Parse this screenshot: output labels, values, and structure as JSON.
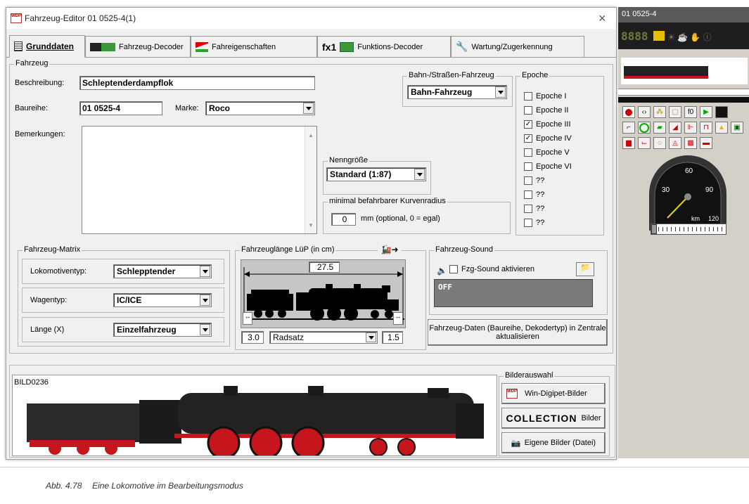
{
  "window": {
    "title": "Fahrzeug-Editor 01 0525-4(1)",
    "close": "×"
  },
  "tabs": [
    {
      "label": "Grunddaten"
    },
    {
      "label": "Fahrzeug-Decoder"
    },
    {
      "label": "Fahreigenschaften"
    },
    {
      "label": "Funktions-Decoder",
      "prefix": "fx1"
    },
    {
      "label": "Wartung/Zugerkennung"
    }
  ],
  "fahrzeug": {
    "legend": "Fahrzeug",
    "beschreibung_label": "Beschreibung:",
    "beschreibung_value": "Schleptenderdampflok",
    "baureihe_label": "Baureihe:",
    "baureihe_value": "01 0525-4",
    "marke_label": "Marke:",
    "marke_value": "Roco",
    "bemerkungen_label": "Bemerkungen:"
  },
  "bahn": {
    "legend": "Bahn-/Straßen-Fahrzeug",
    "value": "Bahn-Fahrzeug"
  },
  "nenngroesse": {
    "legend": "Nenngröße",
    "value": "Standard (1:87)"
  },
  "kurvenradius": {
    "legend": "minimal befahrbarer Kurvenradius",
    "value": "0",
    "hint": "mm (optional, 0 = egal)"
  },
  "epoche": {
    "legend": "Epoche",
    "items": [
      {
        "label": "Epoche I",
        "checked": false,
        "mark": ""
      },
      {
        "label": "Epoche II",
        "checked": false,
        "mark": ""
      },
      {
        "label": "Epoche III",
        "checked": true,
        "mark": "✓"
      },
      {
        "label": "Epoche IV",
        "checked": true,
        "mark": "✓"
      },
      {
        "label": "Epoche V",
        "checked": false,
        "mark": ""
      },
      {
        "label": "Epoche VI",
        "checked": false,
        "mark": ""
      },
      {
        "label": "??",
        "checked": false,
        "mark": ""
      },
      {
        "label": "??",
        "checked": false,
        "mark": ""
      },
      {
        "label": "??",
        "checked": false,
        "mark": ""
      },
      {
        "label": "??",
        "checked": false,
        "mark": ""
      }
    ]
  },
  "matrix": {
    "legend": "Fahrzeug-Matrix",
    "lokotyp_label": "Lokomotiventyp:",
    "lokotyp_value": "Schlepptender",
    "wagentyp_label": "Wagentyp:",
    "wagentyp_value": "IC/ICE",
    "laenge_label": "Länge (X)",
    "laenge_value": "Einzelfahrzeug"
  },
  "laenge": {
    "legend": "Fahrzeuglänge LüP (in cm)",
    "value": "27.5",
    "left_value": "3.0",
    "right_value": "1.5",
    "radsatz": "Radsatz"
  },
  "sound": {
    "legend": "Fahrzeug-Sound",
    "checkbox_label": "Fzg-Sound aktivieren",
    "status": "OFF",
    "update_button": "Fahrzeug-Daten (Baureihe, Dekodertyp) in Zentrale aktualisieren"
  },
  "bild": {
    "name": "BILD0236",
    "legend": "Bilderauswahl",
    "btn1": "Win-Digipet-Bilder",
    "btn2_logo": "COLLECTION",
    "btn2": "Bilder",
    "btn3": "Eigene Bilder (Datei)"
  },
  "side_panel": {
    "title": "01 0525-4",
    "digits": "8888",
    "f0": "f0",
    "speed_marks": [
      "30",
      "60",
      "90",
      "120"
    ],
    "speed_unit": "km",
    "speed_value": 0
  },
  "caption": {
    "number": "Abb. 4.78",
    "text": "Eine Lokomotive im Bearbeitungsmodus"
  },
  "colors": {
    "accent_red": "#cc0000",
    "dark_panel": "#1e1e1e",
    "loco_red": "#c4161c"
  }
}
